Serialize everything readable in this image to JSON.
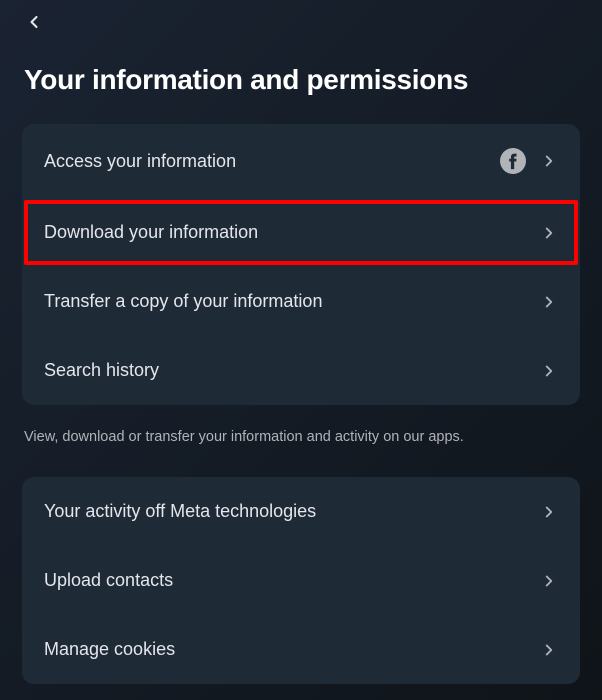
{
  "header": {
    "title": "Your information and permissions"
  },
  "section1": {
    "items": [
      {
        "label": "Access your information",
        "fbIcon": true
      },
      {
        "label": "Download your information",
        "highlighted": true
      },
      {
        "label": "Transfer a copy of your information"
      },
      {
        "label": "Search history"
      }
    ]
  },
  "helpText": "View, download or transfer your information and activity on our apps.",
  "section2": {
    "items": [
      {
        "label": "Your activity off Meta technologies"
      },
      {
        "label": "Upload contacts"
      },
      {
        "label": "Manage cookies"
      }
    ]
  }
}
